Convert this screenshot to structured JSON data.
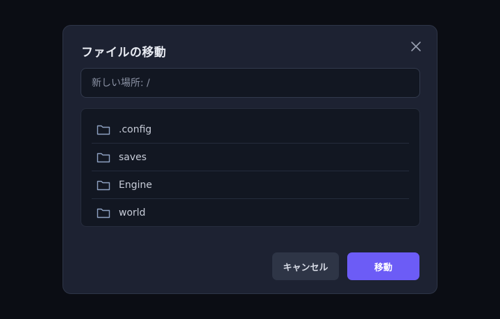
{
  "dialog": {
    "title": "ファイルの移動",
    "close_icon": "close-icon"
  },
  "location_input": {
    "value": "",
    "placeholder": "新しい場所: /"
  },
  "folders": [
    {
      "name": ".config",
      "icon": "folder-icon"
    },
    {
      "name": "saves",
      "icon": "folder-icon"
    },
    {
      "name": "Engine",
      "icon": "folder-icon"
    },
    {
      "name": "world",
      "icon": "folder-icon"
    }
  ],
  "buttons": {
    "cancel_label": "キャンセル",
    "move_label": "移動"
  },
  "colors": {
    "accent": "#6c5cf6",
    "folder_icon": "#8fa3c4"
  }
}
